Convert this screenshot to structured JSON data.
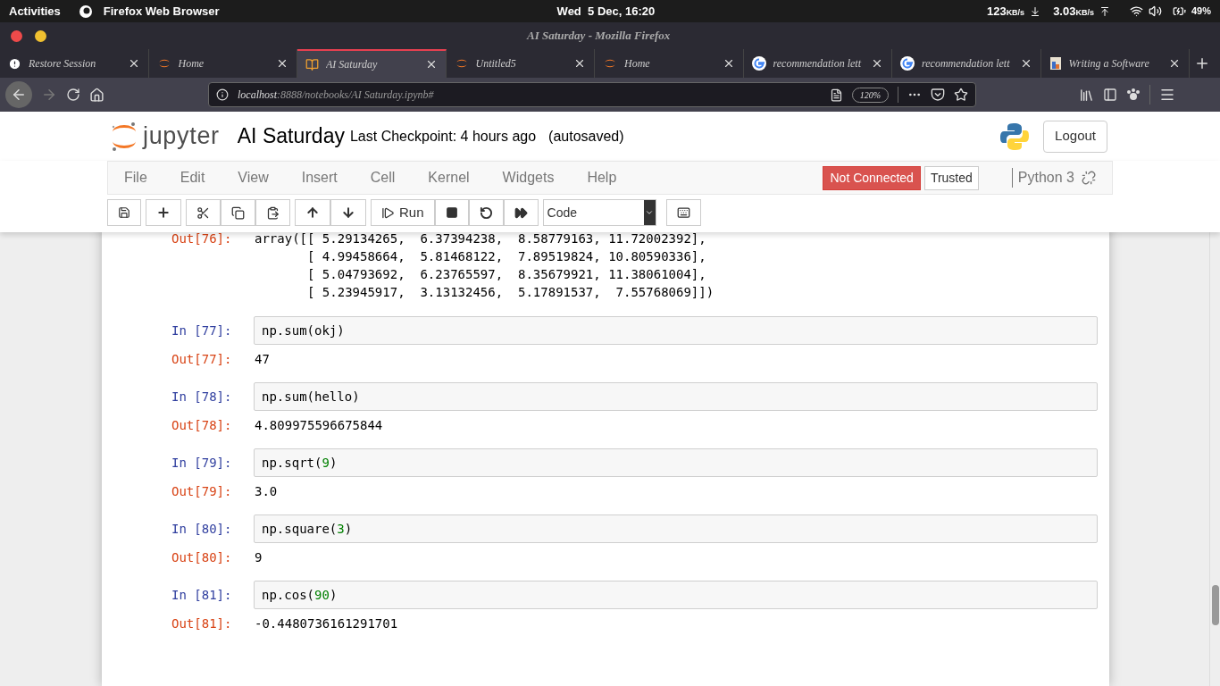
{
  "system_bar": {
    "activities": "Activities",
    "app": "Firefox Web Browser",
    "clock": "Wed  5 Dec, 16:20",
    "download": "123",
    "download_unit": "KB/s",
    "upload": "3.03",
    "upload_unit": "KB/s",
    "battery": "49%"
  },
  "window": {
    "title": "AI Saturday - Mozilla Firefox"
  },
  "tabs": [
    {
      "label": "Restore Session",
      "kind": "warning",
      "selected": false
    },
    {
      "label": "Home",
      "kind": "jupyter",
      "selected": false
    },
    {
      "label": "AI Saturday",
      "kind": "notebook",
      "selected": true
    },
    {
      "label": "Untitled5",
      "kind": "jupyter",
      "selected": false
    },
    {
      "label": "Home",
      "kind": "jupyter",
      "selected": false
    },
    {
      "label": "recommendation lett",
      "kind": "google",
      "selected": false
    },
    {
      "label": "recommendation lett",
      "kind": "google",
      "selected": false
    },
    {
      "label": "Writing a Software",
      "kind": "page",
      "selected": false
    }
  ],
  "address_bar": {
    "host": "localhost",
    "rest": ":8888/notebooks/AI Saturday.ipynb#",
    "zoom": "120%"
  },
  "jupyter": {
    "logo": "jupyter",
    "notebook_name": "AI Saturday",
    "checkpoint": "Last Checkpoint: 4 hours ago",
    "autosave": "(autosaved)",
    "logout": "Logout",
    "menu": [
      "File",
      "Edit",
      "View",
      "Insert",
      "Cell",
      "Kernel",
      "Widgets",
      "Help"
    ],
    "connection": "Not Connected",
    "trusted": "Trusted",
    "kernel": "Python 3",
    "run": "Run",
    "cell_type": "Code"
  },
  "previous_output": {
    "prompt": "Out[76]:",
    "lines": [
      "array([[ 5.29134265,  6.37394238,  8.58779163, 11.72002392],",
      "       [ 4.99458664,  5.81468122,  7.89519824, 10.80590336],",
      "       [ 5.04793692,  6.23765597,  8.35679921, 11.38061004],",
      "       [ 5.23945917,  3.13132456,  5.17891537,  7.55768069]])"
    ]
  },
  "cells": [
    {
      "in_prompt": "In [77]:",
      "code": [
        {
          "kind": "plain",
          "text": "np.sum(okj)"
        }
      ],
      "out_prompt": "Out[77]:",
      "output": "47"
    },
    {
      "in_prompt": "In [78]:",
      "code": [
        {
          "kind": "plain",
          "text": "np.sum(hello)"
        }
      ],
      "out_prompt": "Out[78]:",
      "output": "4.809975596675844"
    },
    {
      "in_prompt": "In [79]:",
      "code": [
        {
          "kind": "plain",
          "text": "np.sqrt("
        },
        {
          "kind": "number",
          "text": "9"
        },
        {
          "kind": "plain",
          "text": ")"
        }
      ],
      "out_prompt": "Out[79]:",
      "output": "3.0"
    },
    {
      "in_prompt": "In [80]:",
      "code": [
        {
          "kind": "plain",
          "text": "np.square("
        },
        {
          "kind": "number",
          "text": "3"
        },
        {
          "kind": "plain",
          "text": ")"
        }
      ],
      "out_prompt": "Out[80]:",
      "output": "9"
    },
    {
      "in_prompt": "In [81]:",
      "code": [
        {
          "kind": "plain",
          "text": "np.cos("
        },
        {
          "kind": "number",
          "text": "90"
        },
        {
          "kind": "plain",
          "text": ")"
        }
      ],
      "out_prompt": "Out[81]:",
      "output": "-0.4480736161291701"
    }
  ]
}
